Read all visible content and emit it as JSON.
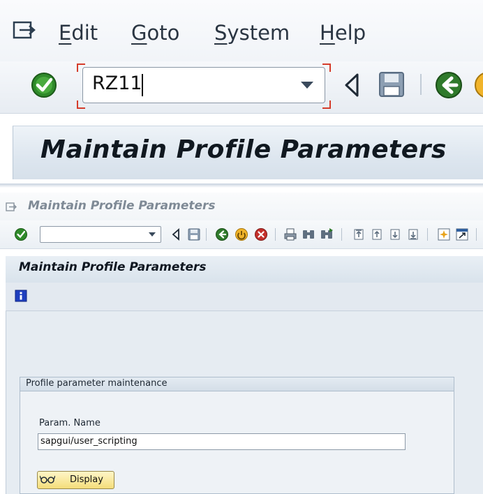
{
  "menu": {
    "items": [
      {
        "underline": "E",
        "rest": "dit"
      },
      {
        "underline": "G",
        "rest": "oto"
      },
      {
        "underline": "S",
        "rest": "ystem"
      },
      {
        "underline": "H",
        "rest": "elp"
      }
    ]
  },
  "command_field": {
    "value": "RZ11"
  },
  "transaction_title": "Maintain Profile Parameters",
  "lower": {
    "window_title": "Maintain Profile Parameters",
    "screen_title": "Maintain Profile Parameters",
    "command_field": {
      "value": ""
    }
  },
  "group": {
    "title": "Profile parameter maintenance",
    "param_label": "Param. Name",
    "param_value": "sapgui/user_scripting",
    "display_button_label": "Display"
  },
  "colors": {
    "enter_green": "#2f8a2a",
    "accent_red": "#d53c2b",
    "button_yellow": "#f4dd7a",
    "info_blue": "#1f3fbf"
  },
  "icons": [
    "menu-icon",
    "enter-icon",
    "back-triangle-icon",
    "save-icon",
    "back-icon",
    "exit-icon",
    "cancel-icon",
    "print-icon",
    "find-icon",
    "find-next-icon",
    "first-page-icon",
    "previous-page-icon",
    "next-page-icon",
    "last-page-icon",
    "create-session-icon",
    "shortcut-icon",
    "info-icon",
    "glasses-icon"
  ]
}
